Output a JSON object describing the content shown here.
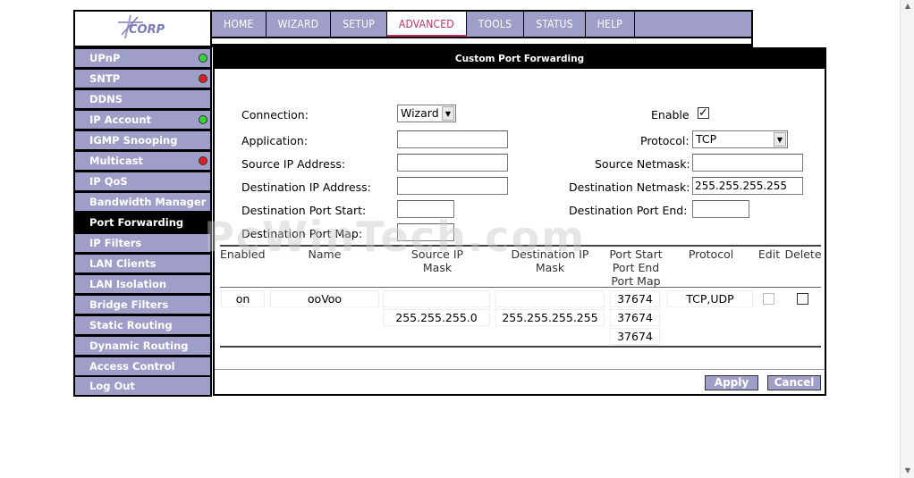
{
  "brand": {
    "logo_text": "ACORP"
  },
  "nav": {
    "tabs": [
      {
        "label": "HOME"
      },
      {
        "label": "WIZARD"
      },
      {
        "label": "SETUP"
      },
      {
        "label": "ADVANCED"
      },
      {
        "label": "TOOLS"
      },
      {
        "label": "STATUS"
      },
      {
        "label": "HELP"
      }
    ],
    "active": "ADVANCED"
  },
  "sidebar": {
    "items": [
      {
        "label": "UPnP",
        "indicator": "green"
      },
      {
        "label": "SNTP",
        "indicator": "red"
      },
      {
        "label": "DDNS"
      },
      {
        "label": "IP Account",
        "indicator": "green"
      },
      {
        "label": "IGMP Snooping"
      },
      {
        "label": "Multicast",
        "indicator": "red"
      },
      {
        "label": "IP QoS"
      },
      {
        "label": "Bandwidth Manager"
      },
      {
        "label": "Port Forwarding",
        "active": true
      },
      {
        "label": "IP Filters"
      },
      {
        "label": "LAN Clients"
      },
      {
        "label": "LAN Isolation"
      },
      {
        "label": "Bridge Filters"
      },
      {
        "label": "Static Routing"
      },
      {
        "label": "Dynamic Routing"
      },
      {
        "label": "Access Control"
      },
      {
        "label": "Log Out"
      }
    ]
  },
  "panel": {
    "title": "Custom Port Forwarding",
    "form": {
      "connection_label": "Connection:",
      "connection_value": "Wizard",
      "enable_label": "Enable",
      "enable_checked": true,
      "application_label": "Application:",
      "application_value": "",
      "protocol_label": "Protocol:",
      "protocol_value": "TCP",
      "source_ip_label": "Source IP Address:",
      "source_ip_value": "",
      "source_netmask_label": "Source Netmask:",
      "source_netmask_value": "",
      "dest_ip_label": "Destination IP Address:",
      "dest_ip_value": "",
      "dest_netmask_label": "Destination Netmask:",
      "dest_netmask_value": "255.255.255.255",
      "dest_port_start_label": "Destination Port Start:",
      "dest_port_start_value": "",
      "dest_port_end_label": "Destination Port End:",
      "dest_port_end_value": "",
      "dest_port_map_label": "Destination Port Map:"
    },
    "table": {
      "headers": {
        "enabled": "Enabled",
        "name": "Name",
        "source": "Source IP Mask",
        "dest": "Destination IP Mask",
        "ports": "Port Start Port End Port Map",
        "protocol": "Protocol",
        "edit": "Edit",
        "delete": "Delete"
      },
      "rows": [
        {
          "enabled": "on",
          "name": "ooVoo",
          "source_ip": "",
          "source_mask": "255.255.255.0",
          "dest_ip": "",
          "dest_mask": "255.255.255.255",
          "port_start": "37674",
          "port_end": "37674",
          "port_map": "37674",
          "protocol": "TCP,UDP"
        }
      ]
    },
    "buttons": {
      "apply": "Apply",
      "cancel": "Cancel"
    }
  },
  "watermark": "PcWinTech.com"
}
